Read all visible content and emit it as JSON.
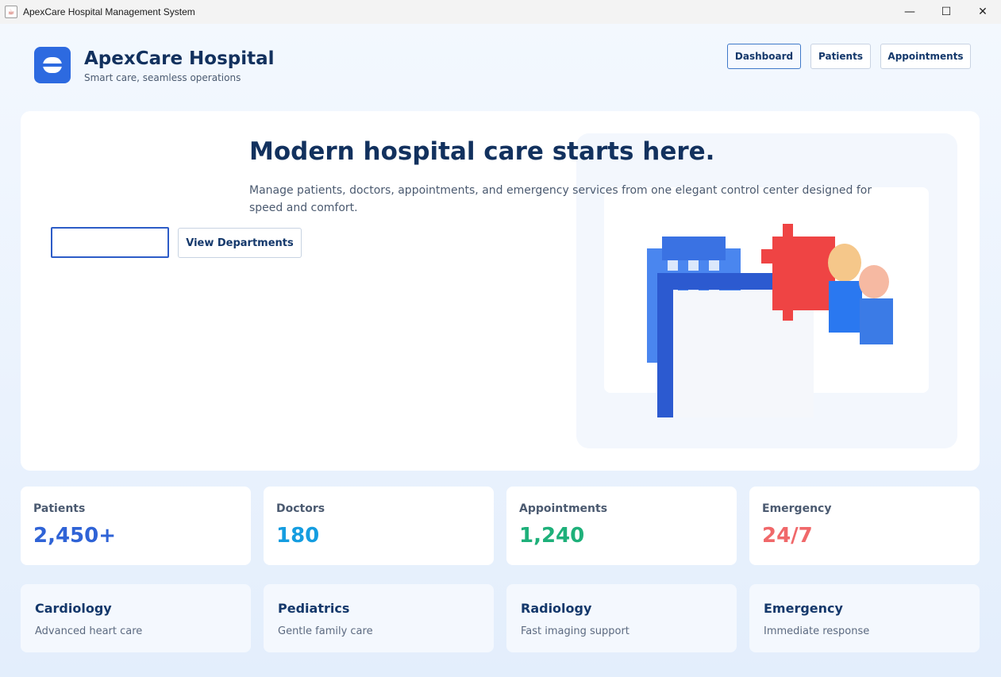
{
  "window": {
    "title": "ApexCare Hospital Management System",
    "controls": {
      "minimize": "—",
      "maximize": "☐",
      "close": "✕"
    }
  },
  "header": {
    "brand_title": "ApexCare Hospital",
    "brand_subtitle": "Smart care, seamless operations",
    "nav": [
      {
        "label": "Dashboard",
        "active": true
      },
      {
        "label": "Patients",
        "active": false
      },
      {
        "label": "Appointments",
        "active": false
      }
    ]
  },
  "hero": {
    "title": "Modern hospital care starts here.",
    "description": "Manage patients, doctors, appointments, and emergency services from one elegant control center designed for speed and comfort.",
    "primary_button": "",
    "secondary_button": "View Departments",
    "illustration": "hospital-building-with-doctors"
  },
  "stats": [
    {
      "label": "Patients",
      "value": "2,450+",
      "color": "#2f63d6"
    },
    {
      "label": "Doctors",
      "value": "180",
      "color": "#159de0"
    },
    {
      "label": "Appointments",
      "value": "1,240",
      "color": "#1eb07a"
    },
    {
      "label": "Emergency",
      "value": "24/7",
      "color": "#f0686a"
    }
  ],
  "departments": [
    {
      "title": "Cardiology",
      "subtitle": "Advanced heart care"
    },
    {
      "title": "Pediatrics",
      "subtitle": "Gentle family care"
    },
    {
      "title": "Radiology",
      "subtitle": "Fast imaging support"
    },
    {
      "title": "Emergency",
      "subtitle": "Immediate response"
    }
  ],
  "colors": {
    "brand": "#2d6ae0",
    "heading": "#12315e",
    "emergency_red": "#ef4444"
  }
}
